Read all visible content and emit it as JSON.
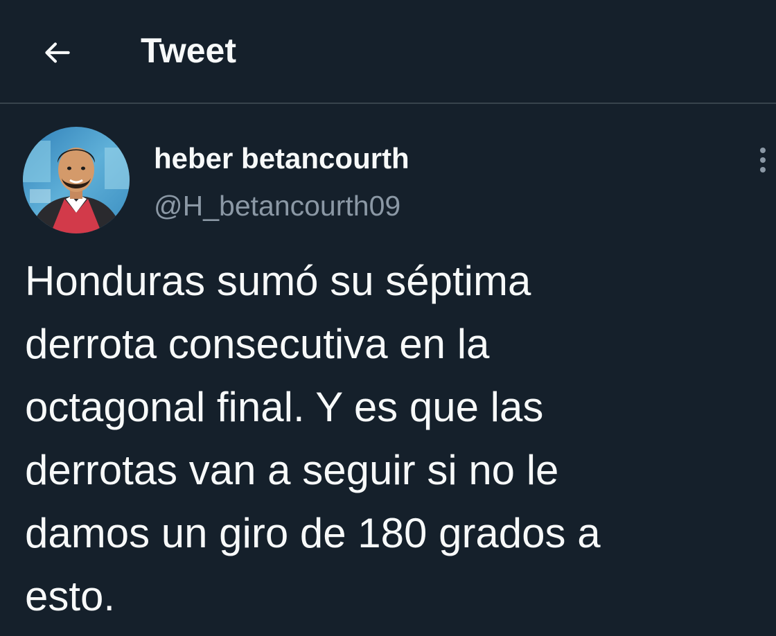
{
  "header": {
    "title": "Tweet",
    "back_icon": "arrow-left-icon"
  },
  "author": {
    "display_name": "heber betancourth",
    "handle": "@H_betancourth09",
    "avatar_icon": "avatar-photo"
  },
  "more_icon": "more-vertical-icon",
  "tweet": {
    "lines": [
      "Honduras sumó su séptima",
      "derrota consecutiva en la",
      "octagonal final. Y es que las",
      "derrotas van a seguir si no le",
      "damos un giro de 180 grados a",
      "esto."
    ]
  },
  "colors": {
    "background": "#15202b",
    "primary_text": "#f7f9f9",
    "secondary_text": "#8b98a5",
    "divider": "#38444d"
  }
}
